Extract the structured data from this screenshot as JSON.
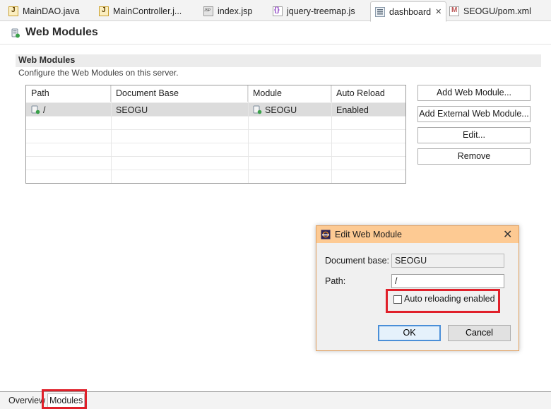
{
  "editor_tabs": [
    {
      "label": "MainDAO.java",
      "icon": "java-file-icon"
    },
    {
      "label": "MainController.j...",
      "icon": "java-file-icon"
    },
    {
      "label": "index.jsp",
      "icon": "jsp-file-icon"
    },
    {
      "label": "jquery-treemap.js",
      "icon": "js-file-icon"
    },
    {
      "label": "dashboard",
      "icon": "server-dashboard-icon",
      "close": "✕"
    },
    {
      "label": "SEOGU/pom.xml",
      "icon": "maven-pom-icon"
    }
  ],
  "form": {
    "title": "Web Modules"
  },
  "section": {
    "title": "Web Modules",
    "description": "Configure the Web Modules on this server."
  },
  "table": {
    "columns": [
      "Path",
      "Document Base",
      "Module",
      "Auto Reload"
    ],
    "rows": [
      {
        "path": "/",
        "document_base": "SEOGU",
        "module": "SEOGU",
        "auto_reload": "Enabled"
      }
    ]
  },
  "actions": {
    "add": "Add Web Module...",
    "add_external": "Add External Web Module...",
    "edit": "Edit...",
    "remove": "Remove"
  },
  "dialog": {
    "title": "Edit Web Module",
    "close": "✕",
    "document_base_label": "Document base:",
    "document_base_value": "SEOGU",
    "path_label": "Path:",
    "path_value": "/",
    "auto_reload_label": "Auto reloading enabled",
    "auto_reload_checked": false,
    "ok": "OK",
    "cancel": "Cancel"
  },
  "bottom_tabs": [
    "Overview",
    "Modules"
  ],
  "colors": {
    "dialog_titlebar": "#fdca93",
    "highlight": "#e0202a",
    "selection": "#dcdcdc"
  }
}
